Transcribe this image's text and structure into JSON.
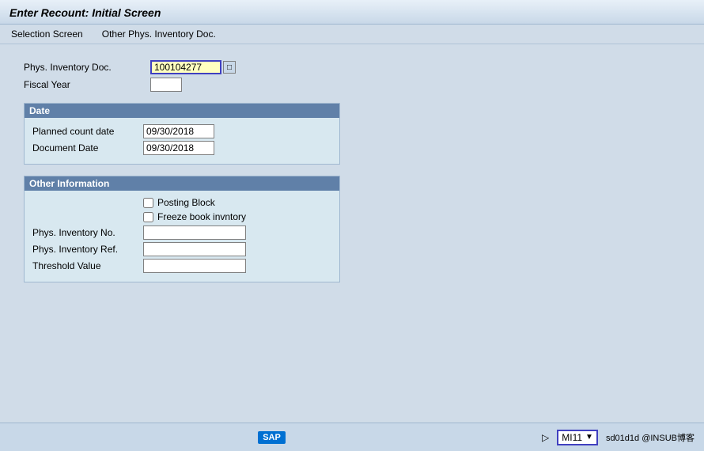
{
  "title": "Enter Recount: Initial Screen",
  "menu": {
    "items": [
      {
        "label": "Selection Screen"
      },
      {
        "label": "Other Phys. Inventory Doc."
      }
    ]
  },
  "form": {
    "phys_inventory_doc_label": "Phys. Inventory Doc.",
    "phys_inventory_doc_value": "100104277",
    "fiscal_year_label": "Fiscal Year",
    "fiscal_year_value": ""
  },
  "date_section": {
    "header": "Date",
    "planned_count_date_label": "Planned count date",
    "planned_count_date_value": "09/30/2018",
    "document_date_label": "Document Date",
    "document_date_value": "09/30/2018"
  },
  "other_section": {
    "header": "Other Information",
    "posting_block_label": "Posting Block",
    "freeze_book_label": "Freeze book invntory",
    "phys_inventory_no_label": "Phys. Inventory No.",
    "phys_inventory_no_value": "",
    "phys_inventory_ref_label": "Phys. Inventory Ref.",
    "phys_inventory_ref_value": "",
    "threshold_value_label": "Threshold Value",
    "threshold_value_value": ""
  },
  "bottom_bar": {
    "sap_logo": "SAP",
    "transaction_code": "MI11",
    "user_info": "sd01d1d @INSUB博客"
  }
}
